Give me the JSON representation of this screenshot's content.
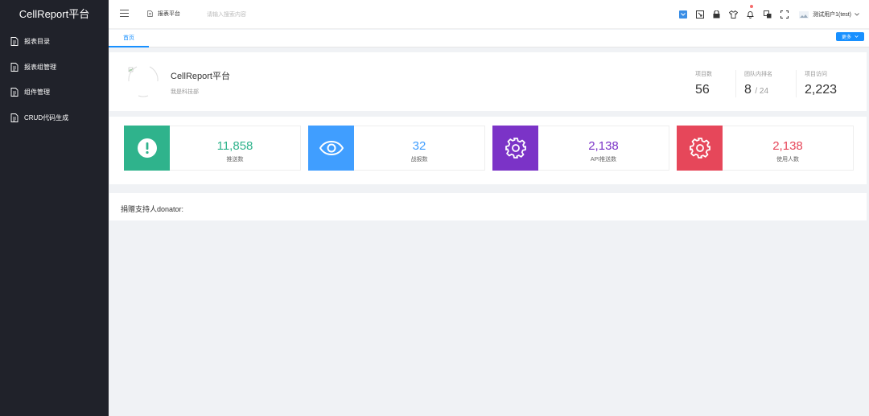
{
  "sidebar": {
    "brand": "CellReport平台",
    "items": [
      {
        "label": "报表目录"
      },
      {
        "label": "报表组管理"
      },
      {
        "label": "组件管理"
      },
      {
        "label": "CRUD代码生成"
      }
    ]
  },
  "header": {
    "breadcrumb": "报表平台",
    "search_placeholder": "请输入搜索内容",
    "user_name": "测试用户1(test)"
  },
  "tabs": {
    "home": "首页",
    "more": "更多"
  },
  "profile": {
    "title": "CellReport平台",
    "subtitle": "我是科技部",
    "stats": [
      {
        "label": "项目数",
        "value": "56"
      },
      {
        "label": "团队内排名",
        "value": "8",
        "sub": "/ 24"
      },
      {
        "label": "项目访问",
        "value": "2,223"
      }
    ]
  },
  "cards": [
    {
      "value": "11,858",
      "label": "推送数",
      "color": "#2fb38c",
      "icon": "alert-icon"
    },
    {
      "value": "32",
      "label": "战报数",
      "color": "#409eff",
      "icon": "eye-icon"
    },
    {
      "value": "2,138",
      "label": "API推送数",
      "color": "#7b33c7",
      "icon": "gear-icon"
    },
    {
      "value": "2,138",
      "label": "使用人数",
      "color": "#e6475a",
      "icon": "gear-icon"
    }
  ],
  "donator": {
    "label": "捐赠支持人donator:"
  }
}
